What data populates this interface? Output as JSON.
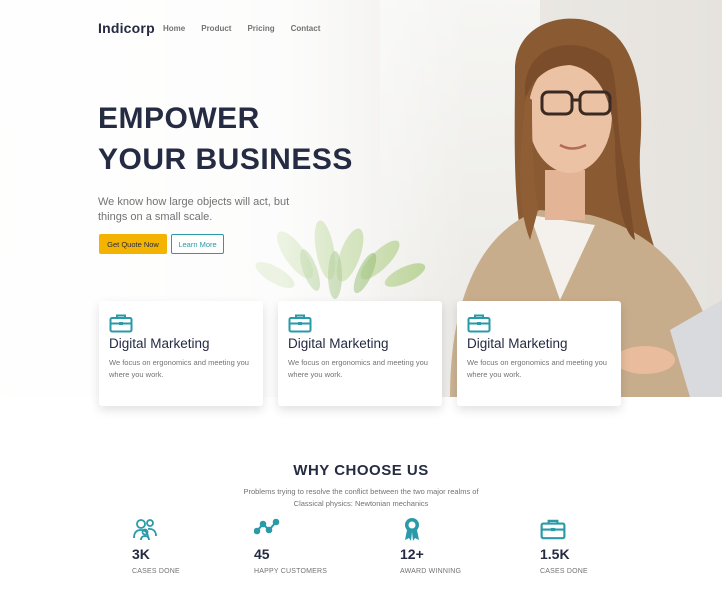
{
  "brand": "Indicorp",
  "nav": [
    "Home",
    "Product",
    "Pricing",
    "Contact"
  ],
  "hero": {
    "headline_line1": "EMPOWER",
    "headline_line2": "YOUR BUSINESS",
    "subtext": "We know how large objects will act, but things on a small scale.",
    "primary_button": "Get Quote Now",
    "secondary_button": "Learn More"
  },
  "cards": [
    {
      "icon": "briefcase-icon",
      "title": "Digital Marketing",
      "text": "We focus on ergonomics and meeting you where you work."
    },
    {
      "icon": "briefcase-icon",
      "title": "Digital Marketing",
      "text": "We focus on ergonomics and meeting you where you work."
    },
    {
      "icon": "briefcase-icon",
      "title": "Digital Marketing",
      "text": "We focus on ergonomics and meeting you where you work."
    }
  ],
  "why": {
    "title": "WHY CHOOSE US",
    "subtitle": "Problems trying to resolve the conflict between the two major realms of Classical physics: Newtonian mechanics"
  },
  "stats": [
    {
      "icon": "users-icon",
      "value": "3K",
      "label": "CASES DONE"
    },
    {
      "icon": "trend-icon",
      "value": "45",
      "label": "HAPPY CUSTOMERS"
    },
    {
      "icon": "award-icon",
      "value": "12+",
      "label": "AWARD WINNING"
    },
    {
      "icon": "briefcase-icon",
      "value": "1.5K",
      "label": "CASES DONE"
    }
  ],
  "colors": {
    "accent": "#2A9AA8",
    "primary_button": "#F3B300",
    "heading": "#252B42",
    "muted": "#737373"
  }
}
